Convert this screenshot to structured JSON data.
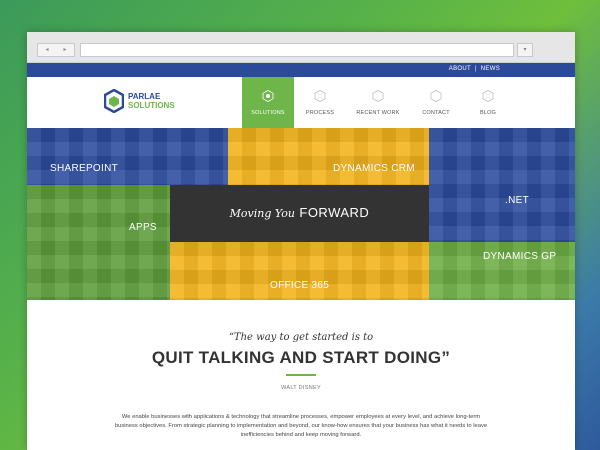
{
  "browser": {
    "back_glyph": "◂",
    "forward_glyph": "▸",
    "go_glyph": "▾"
  },
  "topbar": {
    "about": "ABOUT",
    "separator": "|",
    "news": "NEWS"
  },
  "logo": {
    "line1": "PARLAE",
    "line2": "SOLUTIONS"
  },
  "menu": [
    {
      "label": "SOLUTIONS",
      "active": true
    },
    {
      "label": "PROCESS",
      "active": false
    },
    {
      "label": "RECENT WORK",
      "active": false
    },
    {
      "label": "CONTACT",
      "active": false
    },
    {
      "label": "BLOG",
      "active": false
    }
  ],
  "tiles": {
    "sharepoint": "SHAREPOINT",
    "dynamics_crm": "DYNAMICS CRM",
    "net": ".NET",
    "apps": "APPS",
    "dynamics_gp": "DYNAMICS GP",
    "office365": "OFFICE 365"
  },
  "tagline": {
    "script": "Moving You",
    "bold": "FORWARD"
  },
  "quote": {
    "intro": "“The way to get started is to",
    "main": "QUIT TALKING AND START DOING”",
    "author": "WALT DISNEY"
  },
  "body_text": "We enable businesses with applications & technology that streamline processes, empower employees at every level, and achieve long-term business objectives. From strategic planning to implementation and beyond, our know-how ensures that your business has what it needs to leave inefficiencies behind and keep moving forward.",
  "colors": {
    "blue": "#2b4a9a",
    "green": "#6fb64a",
    "yellow": "#f2b31c",
    "dark": "#333333"
  }
}
